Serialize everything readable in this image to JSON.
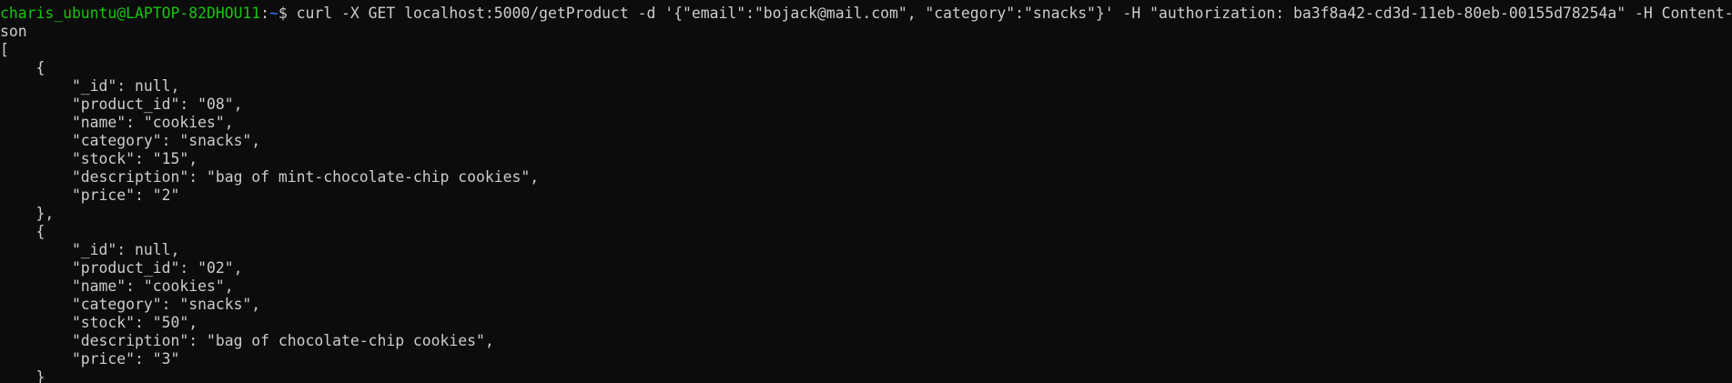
{
  "terminal": {
    "colors": {
      "background": "#0c0c0c",
      "foreground": "#cccccc",
      "prompt_user": "#16c60c",
      "prompt_path": "#3b78ff"
    },
    "prompt": {
      "user_host": "charis_ubuntu@LAPTOP-82DHOU11",
      "separator": ":",
      "path": "~",
      "symbol": "$ "
    },
    "command": "curl -X GET localhost:5000/getProduct -d '{\"email\":\"bojack@mail.com\", \"category\":\"snacks\"}' -H \"authorization: ba3f8a42-cd3d-11eb-80eb-00155d78254a\" -H Content-Type:application/j",
    "command_wrap": "son",
    "output": [
      "[",
      "    {",
      "        \"_id\": null,",
      "        \"product_id\": \"08\",",
      "        \"name\": \"cookies\",",
      "        \"category\": \"snacks\",",
      "        \"stock\": \"15\",",
      "        \"description\": \"bag of mint-chocolate-chip cookies\",",
      "        \"price\": \"2\"",
      "    },",
      "    {",
      "        \"_id\": null,",
      "        \"product_id\": \"02\",",
      "        \"name\": \"cookies\",",
      "        \"category\": \"snacks\",",
      "        \"stock\": \"50\",",
      "        \"description\": \"bag of chocolate-chip cookies\",",
      "        \"price\": \"3\"",
      "    }"
    ]
  }
}
